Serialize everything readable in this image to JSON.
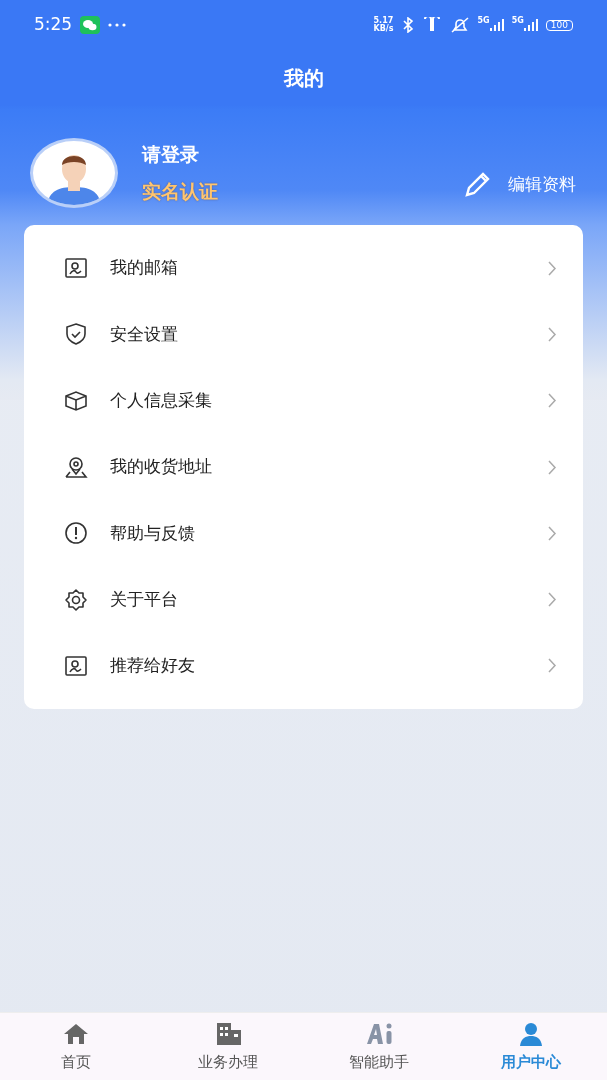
{
  "status_bar": {
    "time": "5:25",
    "speed": "5.17",
    "speed_unit": "KB/s",
    "network_1": "5G",
    "network_2": "5G",
    "battery": "100"
  },
  "header": {
    "title": "我的"
  },
  "profile": {
    "name": "请登录",
    "verify": "实名认证",
    "edit": "编辑资料"
  },
  "menu": [
    {
      "kind": "card",
      "label": "我的邮箱"
    },
    {
      "kind": "shield",
      "label": "安全设置"
    },
    {
      "kind": "box",
      "label": "个人信息采集"
    },
    {
      "kind": "location",
      "label": "我的收货地址"
    },
    {
      "kind": "alert",
      "label": "帮助与反馈"
    },
    {
      "kind": "gear",
      "label": "关于平台"
    },
    {
      "kind": "card",
      "label": "推荐给好友"
    }
  ],
  "tab_bar": [
    {
      "kind": "home",
      "label": "首页",
      "selected": false
    },
    {
      "kind": "building",
      "label": "业务办理",
      "selected": false
    },
    {
      "kind": "ai",
      "label": "智能助手",
      "selected": false
    },
    {
      "kind": "user",
      "label": "用户中心",
      "selected": true
    }
  ]
}
